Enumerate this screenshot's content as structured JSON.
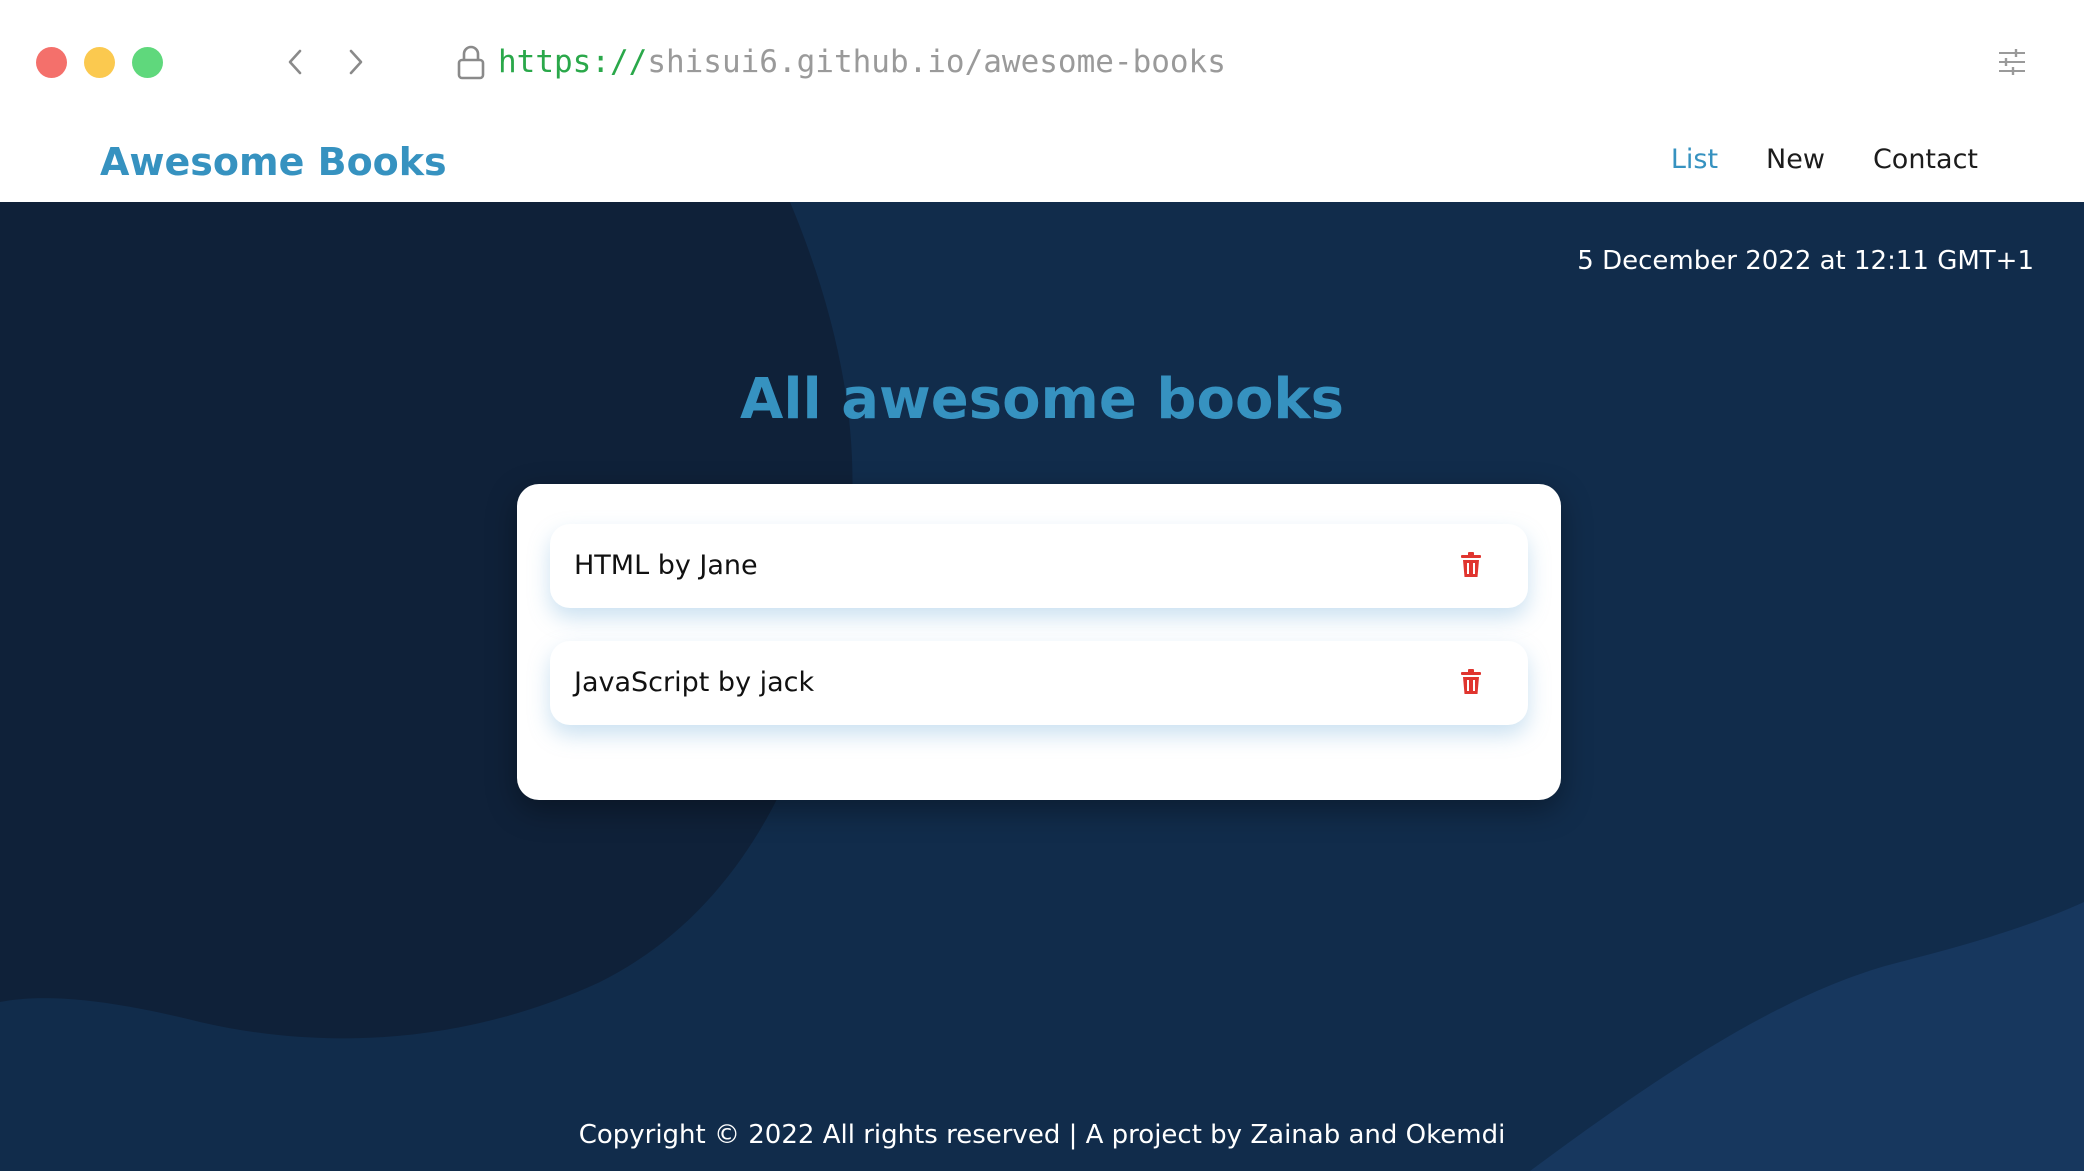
{
  "browser": {
    "url_scheme": "https://",
    "url_rest": "shisui6.github.io/awesome-books",
    "icons": {
      "back": "chevron-left-icon",
      "forward": "chevron-right-icon",
      "lock": "lock-icon",
      "settings": "sliders-icon"
    },
    "traffic_colors": [
      "#f4706b",
      "#fbc94f",
      "#5fd87c"
    ]
  },
  "header": {
    "brand": "Awesome Books",
    "nav": [
      {
        "label": "List",
        "active": true
      },
      {
        "label": "New",
        "active": false
      },
      {
        "label": "Contact",
        "active": false
      }
    ]
  },
  "main": {
    "date": "5 December 2022 at 12:11 GMT+1",
    "heading": "All awesome books",
    "books": [
      {
        "title": "HTML by Jane"
      },
      {
        "title": "JavaScript by jack"
      }
    ],
    "delete_icon": "trash-icon"
  },
  "footer": {
    "text": "Copyright © 2022 All rights reserved | A project by Zainab and Okemdi"
  },
  "colors": {
    "accent": "#3692c0",
    "background": "#112c4b",
    "background_dark": "#0f2139",
    "background_light": "#122b4c",
    "delete": "#e0352f",
    "nav_text": "#1c1c1c"
  }
}
